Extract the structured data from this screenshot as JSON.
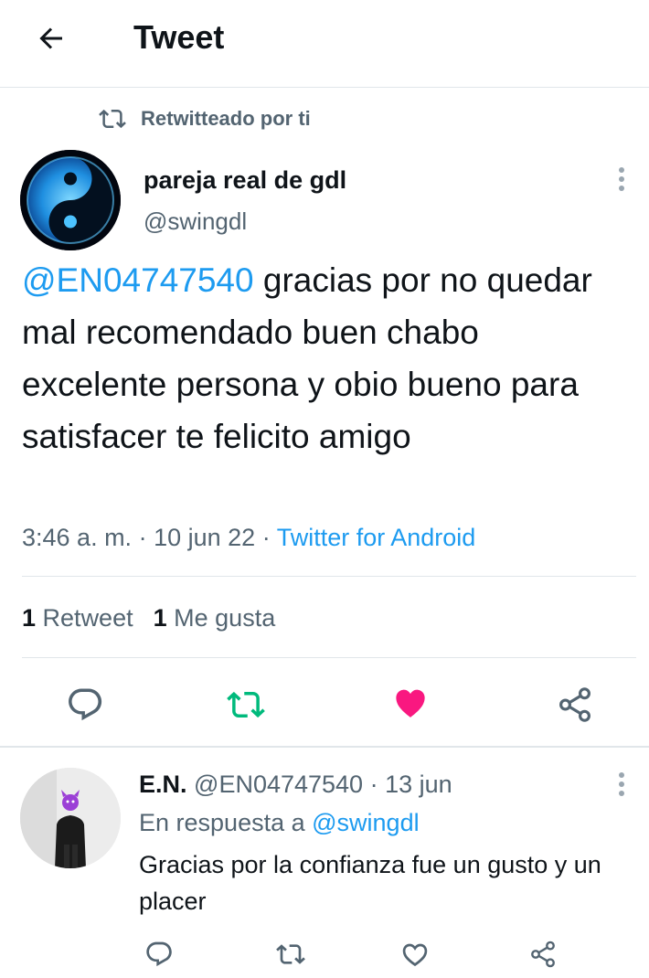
{
  "header": {
    "title": "Tweet",
    "back_icon": "arrow-left-icon"
  },
  "retweet_context": {
    "label": "Retwitteado por ti",
    "icon": "retweet-icon"
  },
  "tweet": {
    "author_name": "pareja real de gdl",
    "author_handle": "@swingdl",
    "mention": "@EN04747540",
    "text": " gracias por no quedar mal recomendado buen chabo excelente persona y obio bueno para satisfacer te felicito amigo",
    "time": "3:46 a. m.",
    "dot1": " · ",
    "date": "10 jun 22",
    "dot2": " · ",
    "source": "Twitter for Android",
    "retweet_count": "1",
    "retweet_label": "Retweet",
    "like_count": "1",
    "like_label": "Me gusta",
    "liked": true,
    "retweeted": true
  },
  "reply": {
    "author_name": "E.N.",
    "author_handle": "@EN04747540",
    "separator": " · ",
    "date": "13 jun",
    "reply_prefix": "En respuesta a ",
    "reply_to": "@swingdl",
    "text": "Gracias por la confianza fue un gusto y un placer"
  },
  "colors": {
    "accent": "#1d9bf0",
    "retweet_green": "#00ba7c",
    "like_pink": "#f91880",
    "muted": "#536471",
    "text": "#0f1419",
    "divider": "#e1e6ea"
  }
}
